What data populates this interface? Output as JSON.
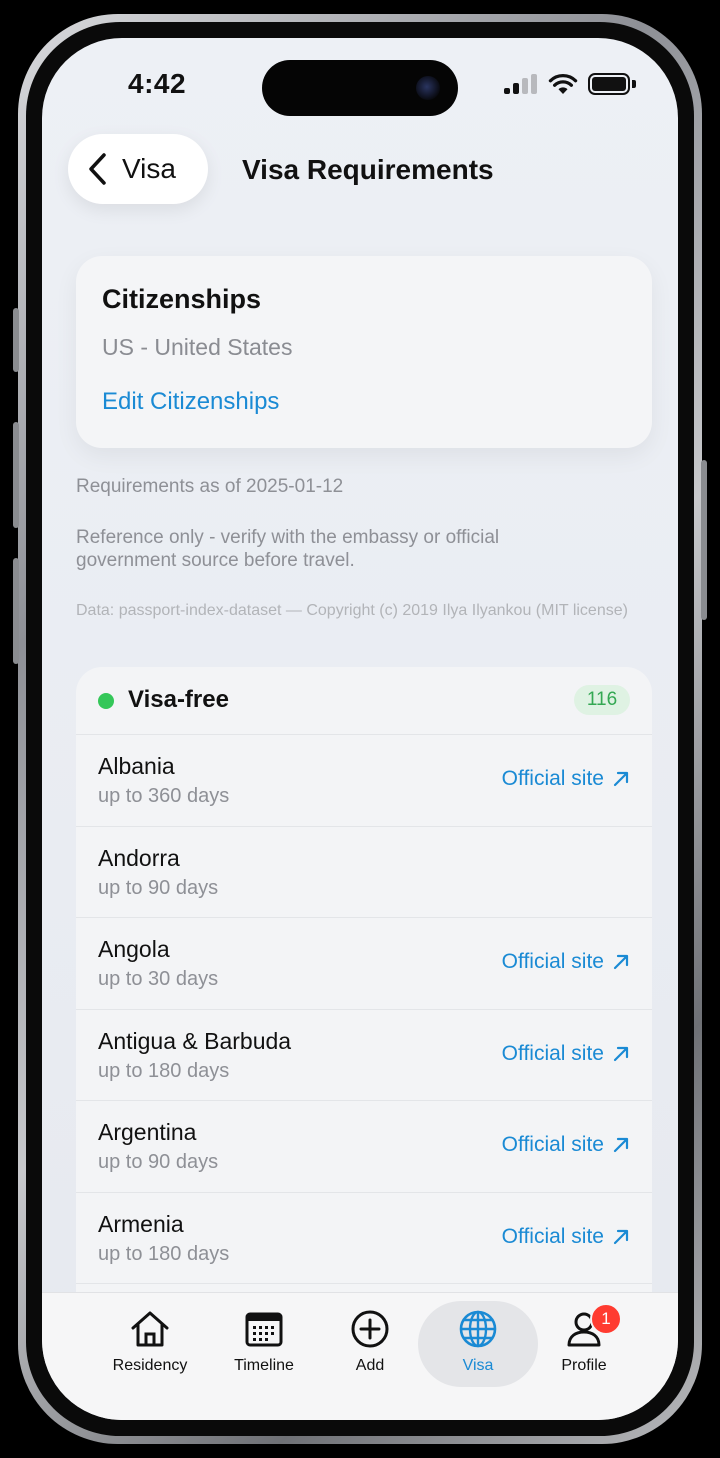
{
  "status_bar": {
    "time": "4:42"
  },
  "header": {
    "back_label": "Visa",
    "title": "Visa Requirements"
  },
  "citizenships": {
    "title": "Citizenships",
    "value": "US - United States",
    "edit_label": "Edit Citizenships"
  },
  "notes": {
    "date": "Requirements as of 2025-01-12",
    "reference": "Reference only - verify with the embassy or official government source before travel.",
    "data_source": "Data: passport-index-dataset — Copyright (c) 2019 Ilya Ilyankou (MIT license)"
  },
  "visa_free": {
    "label": "Visa-free",
    "count": "116",
    "status_color": "#34c759",
    "countries": [
      {
        "name": "Albania",
        "duration": "up to 360 days",
        "link": "Official site"
      },
      {
        "name": "Andorra",
        "duration": "up to 90 days",
        "link": ""
      },
      {
        "name": "Angola",
        "duration": "up to 30 days",
        "link": "Official site"
      },
      {
        "name": "Antigua & Barbuda",
        "duration": "up to 180 days",
        "link": "Official site"
      },
      {
        "name": "Argentina",
        "duration": "up to 90 days",
        "link": "Official site"
      },
      {
        "name": "Armenia",
        "duration": "up to 180 days",
        "link": "Official site"
      }
    ]
  },
  "tabbar": {
    "accent": "#1a8ad4",
    "tabs": [
      {
        "label": "Residency",
        "icon": "house-icon"
      },
      {
        "label": "Timeline",
        "icon": "calendar-icon"
      },
      {
        "label": "Add",
        "icon": "plus-circle-icon"
      },
      {
        "label": "Visa",
        "icon": "globe-icon",
        "active": true
      },
      {
        "label": "Profile",
        "icon": "person-icon",
        "badge": "1"
      }
    ]
  }
}
